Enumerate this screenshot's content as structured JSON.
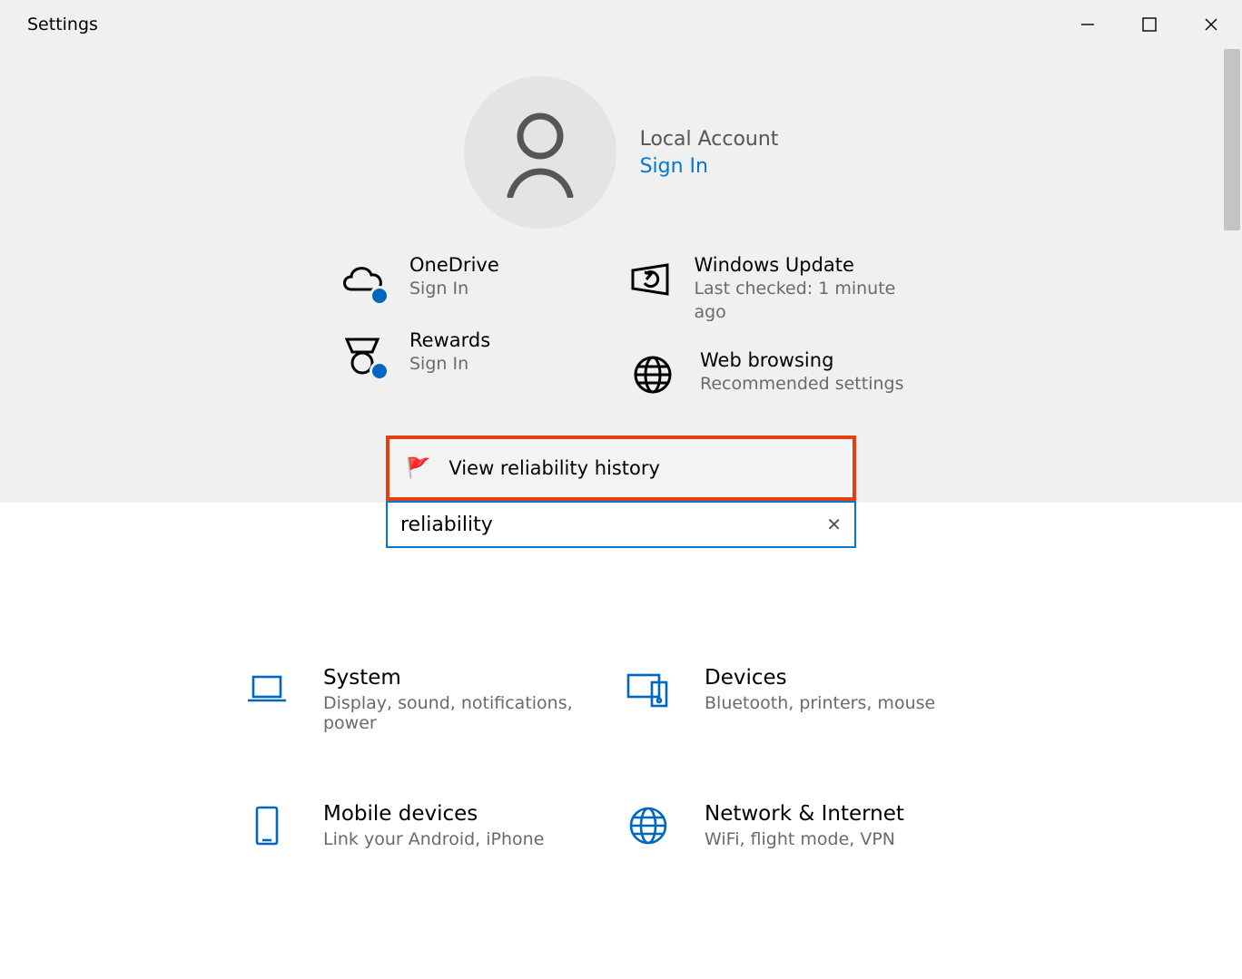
{
  "titlebar": {
    "title": "Settings"
  },
  "account": {
    "label": "Local Account",
    "sign_in": "Sign In"
  },
  "tiles": {
    "onedrive": {
      "title": "OneDrive",
      "sub": "Sign In"
    },
    "windows_update": {
      "title": "Windows Update",
      "sub": "Last checked: 1 minute ago"
    },
    "rewards": {
      "title": "Rewards",
      "sub": "Sign In"
    },
    "web_browsing": {
      "title": "Web browsing",
      "sub": "Recommended settings"
    }
  },
  "search": {
    "query": "reliability",
    "suggestion": "View reliability history"
  },
  "categories": {
    "system": {
      "title": "System",
      "sub": "Display, sound, notifications, power"
    },
    "devices": {
      "title": "Devices",
      "sub": "Bluetooth, printers, mouse"
    },
    "mobile": {
      "title": "Mobile devices",
      "sub": "Link your Android, iPhone"
    },
    "network": {
      "title": "Network & Internet",
      "sub": "WiFi, flight mode, VPN"
    }
  }
}
